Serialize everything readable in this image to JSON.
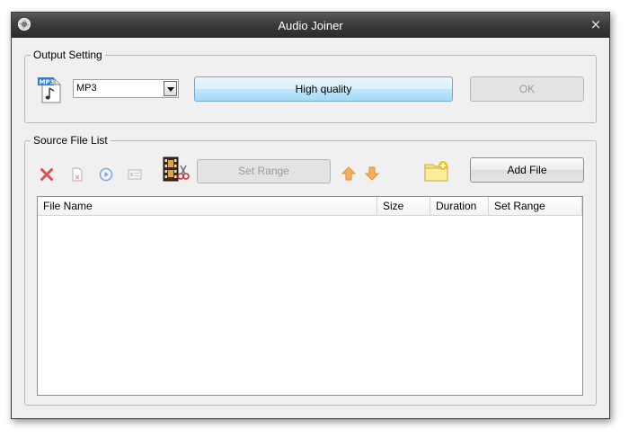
{
  "window": {
    "title": "Audio Joiner",
    "close_glyph": "×"
  },
  "output_setting": {
    "legend": "Output Setting",
    "format_icon": "mp3-file-icon",
    "format_value": "MP3",
    "quality_button": "High quality",
    "ok_button": "OK"
  },
  "source_list": {
    "legend": "Source File List",
    "toolbar": {
      "remove_icon": "red-x-icon",
      "remove_all_icon": "clear-file-icon",
      "play_icon": "play-icon",
      "info_icon": "info-card-icon",
      "cut_icon": "film-scissors-icon",
      "set_range_button": "Set Range",
      "up_icon": "arrow-up-icon",
      "down_icon": "arrow-down-icon",
      "add_folder_icon": "add-folder-icon",
      "add_file_button": "Add File"
    },
    "columns": [
      "File Name",
      "Size",
      "Duration",
      "Set Range"
    ],
    "rows": []
  }
}
